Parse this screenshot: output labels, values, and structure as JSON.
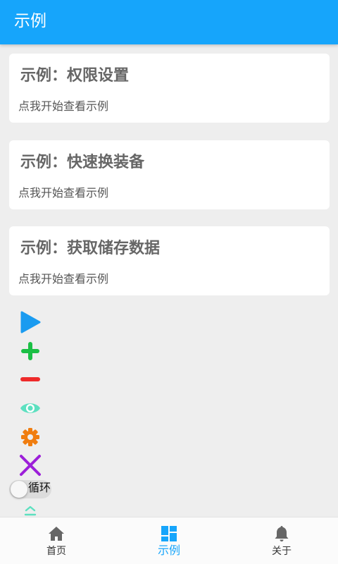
{
  "app_bar": {
    "title": "示例"
  },
  "cards": [
    {
      "title": "示例：权限设置",
      "subtitle": "点我开始查看示例"
    },
    {
      "title": "示例：快速换装备",
      "subtitle": "点我开始查看示例"
    },
    {
      "title": "示例：获取储存数据",
      "subtitle": "点我开始查看示例"
    }
  ],
  "floating_controls": [
    {
      "icon": "play-icon",
      "color": "#1a9bf0"
    },
    {
      "icon": "plus-icon",
      "color": "#1bbf45"
    },
    {
      "icon": "minus-icon",
      "color": "#ee2a2a"
    },
    {
      "icon": "eye-icon",
      "color": "#5de0c0"
    },
    {
      "icon": "gear-icon",
      "color": "#f07d10"
    },
    {
      "icon": "close-icon",
      "color": "#9c1fd9"
    }
  ],
  "loop_toggle": {
    "label": "循环",
    "enabled": false
  },
  "scroll_up": {
    "icon": "chevron-up-icon",
    "color": "#5de0c0"
  },
  "bottom_nav": {
    "active_color": "#16a5fb",
    "items": [
      {
        "label": "首页",
        "icon": "home-icon",
        "active": false
      },
      {
        "label": "示例",
        "icon": "dashboard-icon",
        "active": true
      },
      {
        "label": "关于",
        "icon": "bell-icon",
        "active": false
      }
    ]
  },
  "colors": {
    "primary": "#16a5fb",
    "background": "#eeeeee"
  }
}
